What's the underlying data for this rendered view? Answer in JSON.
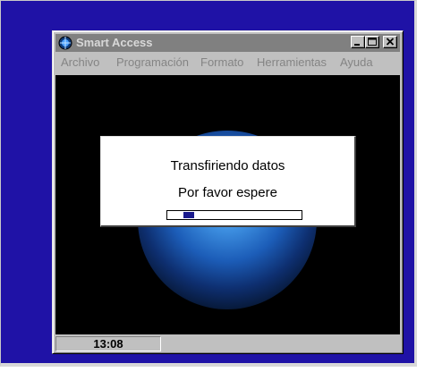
{
  "window": {
    "title": "Smart Access",
    "title_bar_color": "#808080",
    "desktop_color": "#1f12a6",
    "controls": [
      "minimize-icon",
      "maximize-icon",
      "close-icon"
    ]
  },
  "menu": [
    {
      "label": "Archivo"
    },
    {
      "label": "Programación"
    },
    {
      "label": "Formato"
    },
    {
      "label": "Herramientas"
    },
    {
      "label": "Ayuda"
    }
  ],
  "dialog": {
    "line1": "Transfiriendo datos",
    "line2": "Por favor espere",
    "progress": {
      "start": 0.12,
      "end": 0.2,
      "fill_color": "#1a1a8c"
    }
  },
  "status": {
    "time": "13:08"
  }
}
